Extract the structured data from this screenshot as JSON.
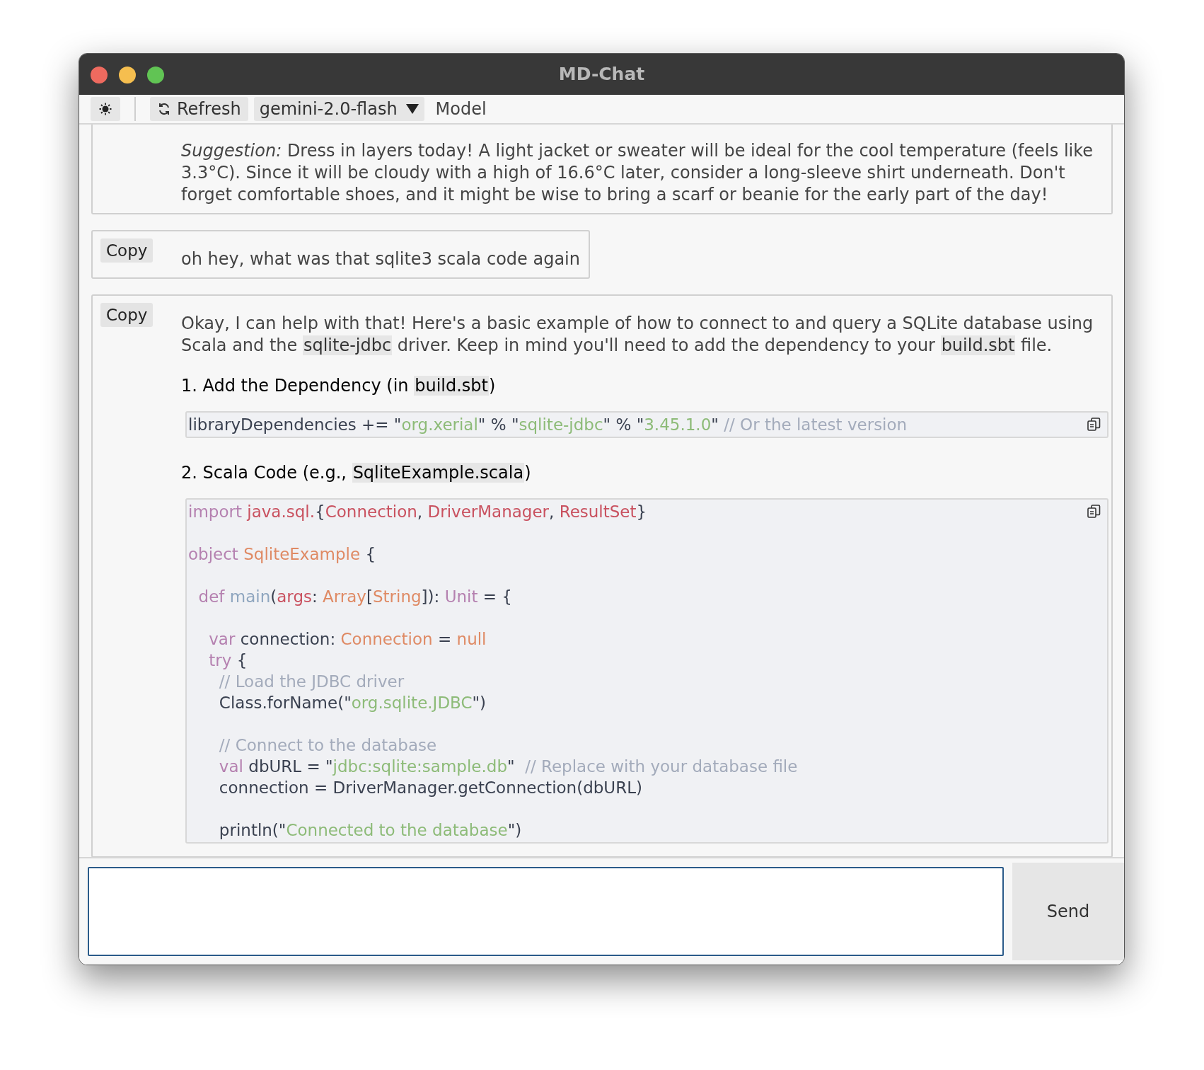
{
  "window": {
    "title": "MD-Chat"
  },
  "toolbar": {
    "refresh_label": "Refresh",
    "model_value": "gemini-2.0-flash",
    "model_label": "Model"
  },
  "messages": [
    {
      "kind": "assistant",
      "cut_top": true,
      "blocks": [
        {
          "kind": "paragraph",
          "segments": [
            {
              "kind": "rich",
              "text": "*Suggestion:* Dress in layers today! A light jacket or sweater will be ideal for the cool temperature (feels like 3.3°C). Since it will be cloudy with a high of 16.6°C later, consider a long-sleeve shirt underneath. Don't forget comfortable shoes, and it might be wise to bring a scarf or beanie for the early part of the day!"
            }
          ]
        }
      ]
    },
    {
      "kind": "user",
      "cut_top": false,
      "copy_label": "Copy",
      "blocks": [
        {
          "kind": "paragraph",
          "segments": [
            {
              "kind": "rich",
              "text": "oh hey, what was that sqlite3 scala code again"
            }
          ]
        }
      ]
    },
    {
      "kind": "assistant",
      "cut_top": false,
      "copy_label": "Copy",
      "blocks": [
        {
          "kind": "paragraph",
          "segments": [
            {
              "kind": "rich",
              "text": "Okay, I can help with that! Here's a basic example of how to connect to and query a SQLite database using Scala and the "
            },
            {
              "kind": "code",
              "text": "sqlite-jdbc"
            },
            {
              "kind": "rich",
              "text": " driver.  Keep in mind you'll need to add the dependency to your "
            },
            {
              "kind": "code",
              "text": "build.sbt"
            },
            {
              "kind": "rich",
              "text": " file."
            }
          ]
        },
        {
          "kind": "heading",
          "segments": [
            {
              "kind": "rich",
              "text": "1. Add the Dependency (in "
            },
            {
              "kind": "code",
              "text": "build.sbt"
            },
            {
              "kind": "rich",
              "text": ")"
            }
          ]
        },
        {
          "kind": "code",
          "lines": [
            {
              "kind": "code",
              "tokens": [
                {
                  "kind": "plain",
                  "text": "libraryDependencies += \""
                },
                {
                  "kind": "string",
                  "text": "org.xerial"
                },
                {
                  "kind": "plain",
                  "text": "\" % \""
                },
                {
                  "kind": "string",
                  "text": "sqlite-jdbc"
                },
                {
                  "kind": "plain",
                  "text": "\" % \""
                },
                {
                  "kind": "string",
                  "text": "3.45.1.0"
                },
                {
                  "kind": "plain",
                  "text": "\" "
                },
                {
                  "kind": "comment",
                  "text": "// Or the latest version"
                }
              ]
            }
          ]
        },
        {
          "kind": "heading",
          "segments": [
            {
              "kind": "rich",
              "text": "2. Scala Code (e.g., "
            },
            {
              "kind": "code",
              "text": "SqliteExample.scala"
            },
            {
              "kind": "rich",
              "text": ")"
            }
          ]
        },
        {
          "kind": "code",
          "lines": [
            {
              "kind": "code",
              "tokens": [
                {
                  "kind": "keyword",
                  "text": "import "
                },
                {
                  "kind": "ident",
                  "text": "java.sql."
                },
                {
                  "kind": "plain",
                  "text": "{"
                },
                {
                  "kind": "ident",
                  "text": "Connection"
                },
                {
                  "kind": "plain",
                  "text": ", "
                },
                {
                  "kind": "ident",
                  "text": "DriverManager"
                },
                {
                  "kind": "plain",
                  "text": ", "
                },
                {
                  "kind": "ident",
                  "text": "ResultSet"
                },
                {
                  "kind": "plain",
                  "text": "}"
                }
              ]
            },
            {
              "kind": "blank"
            },
            {
              "kind": "code",
              "tokens": [
                {
                  "kind": "keyword",
                  "text": "object "
                },
                {
                  "kind": "type",
                  "text": "SqliteExample"
                },
                {
                  "kind": "plain",
                  "text": " {"
                }
              ]
            },
            {
              "kind": "blank"
            },
            {
              "kind": "code",
              "tokens": [
                {
                  "kind": "keyword",
                  "text": "  def "
                },
                {
                  "kind": "function",
                  "text": "main"
                },
                {
                  "kind": "plain",
                  "text": "("
                },
                {
                  "kind": "ident",
                  "text": "args"
                },
                {
                  "kind": "plain",
                  "text": ": "
                },
                {
                  "kind": "type",
                  "text": "Array"
                },
                {
                  "kind": "plain",
                  "text": "["
                },
                {
                  "kind": "type",
                  "text": "String"
                },
                {
                  "kind": "plain",
                  "text": "]): "
                },
                {
                  "kind": "keyword",
                  "text": "Unit"
                },
                {
                  "kind": "plain",
                  "text": " = {"
                }
              ]
            },
            {
              "kind": "blank"
            },
            {
              "kind": "code",
              "tokens": [
                {
                  "kind": "keyword",
                  "text": "    var "
                },
                {
                  "kind": "plain",
                  "text": "connection: "
                },
                {
                  "kind": "type",
                  "text": "Connection"
                },
                {
                  "kind": "plain",
                  "text": " = "
                },
                {
                  "kind": "type",
                  "text": "null"
                }
              ]
            },
            {
              "kind": "code",
              "tokens": [
                {
                  "kind": "keyword",
                  "text": "    try "
                },
                {
                  "kind": "plain",
                  "text": "{"
                }
              ]
            },
            {
              "kind": "code",
              "tokens": [
                {
                  "kind": "comment",
                  "text": "      // Load the JDBC driver"
                }
              ]
            },
            {
              "kind": "code",
              "tokens": [
                {
                  "kind": "plain",
                  "text": "      Class.forName(\""
                },
                {
                  "kind": "string",
                  "text": "org.sqlite.JDBC"
                },
                {
                  "kind": "plain",
                  "text": "\")"
                }
              ]
            },
            {
              "kind": "blank"
            },
            {
              "kind": "code",
              "tokens": [
                {
                  "kind": "comment",
                  "text": "      // Connect to the database"
                }
              ]
            },
            {
              "kind": "code",
              "tokens": [
                {
                  "kind": "keyword",
                  "text": "      val "
                },
                {
                  "kind": "plain",
                  "text": "dbURL = \""
                },
                {
                  "kind": "string",
                  "text": "jdbc:sqlite:sample.db"
                },
                {
                  "kind": "plain",
                  "text": "\"  "
                },
                {
                  "kind": "comment",
                  "text": "// Replace with your database file"
                }
              ]
            },
            {
              "kind": "code",
              "tokens": [
                {
                  "kind": "plain",
                  "text": "      connection = DriverManager.getConnection(dbURL)"
                }
              ]
            },
            {
              "kind": "blank"
            },
            {
              "kind": "code",
              "tokens": [
                {
                  "kind": "plain",
                  "text": "      println(\""
                },
                {
                  "kind": "string",
                  "text": "Connected to the database"
                },
                {
                  "kind": "plain",
                  "text": "\")"
                }
              ]
            }
          ]
        }
      ]
    }
  ],
  "composer": {
    "send_label": "Send"
  }
}
